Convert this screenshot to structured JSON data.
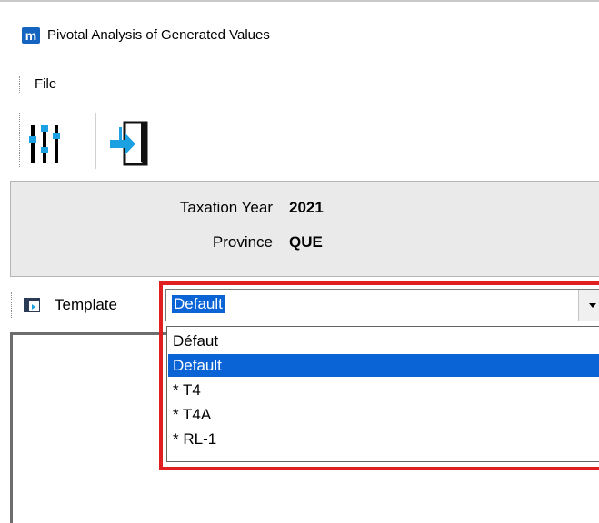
{
  "window": {
    "app_icon_letter": "m",
    "title": "Pivotal Analysis of Generated Values"
  },
  "menu": {
    "file_label": "File"
  },
  "toolbar": {
    "buttons": [
      {
        "name": "settings-sliders",
        "icon": "sliders-icon"
      },
      {
        "name": "exit",
        "icon": "exit-door-icon"
      }
    ]
  },
  "info": {
    "tax_year_label": "Taxation Year",
    "tax_year_value": "2021",
    "province_label": "Province",
    "province_value": "QUE"
  },
  "template": {
    "label": "Template",
    "selected": "Default",
    "options": [
      "Défaut",
      "Default",
      "* T4",
      "* T4A",
      "* RL-1"
    ],
    "selected_index": 1
  },
  "colors": {
    "selection": "#0a64d6",
    "highlight_border": "#e02020",
    "icon_blue": "#1ba1e2",
    "app_icon": "#1565c0"
  }
}
